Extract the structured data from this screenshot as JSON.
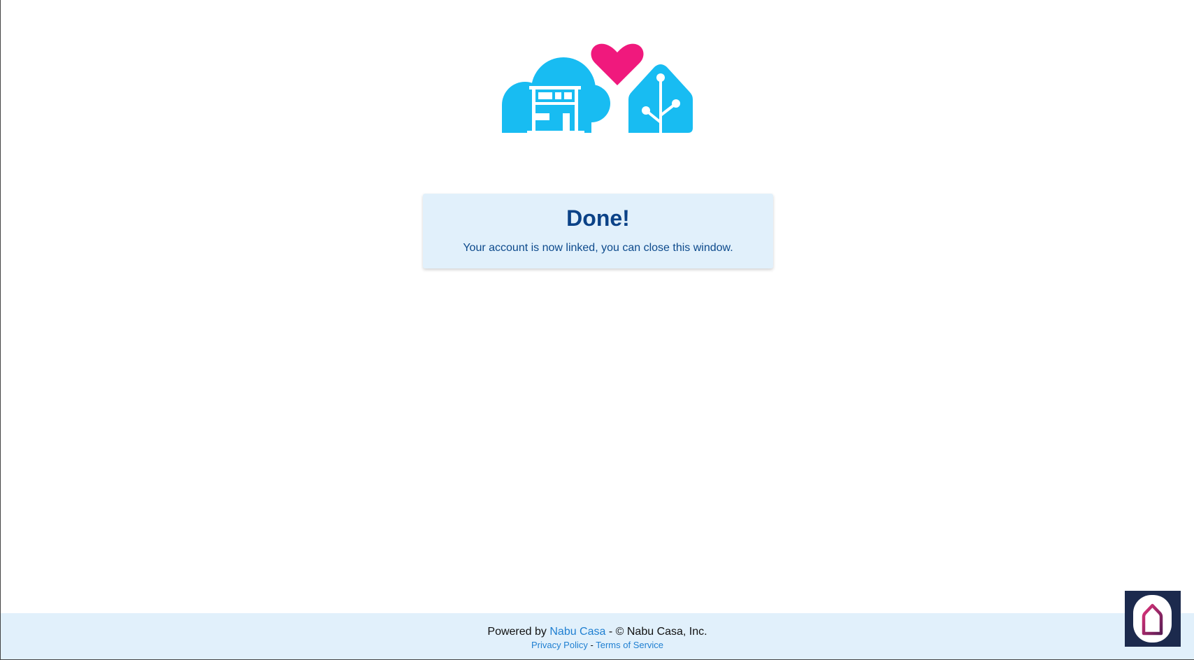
{
  "logo": {
    "icon": "nabu-casa-cloud-heart-home-logo",
    "colors": {
      "cloud": "#18bcf2",
      "heart": "#f0197d",
      "home": "#18bcf2"
    }
  },
  "card": {
    "title": "Done!",
    "message": "Your account is now linked, you can close this window."
  },
  "footer": {
    "powered_by": "Powered by",
    "nabu_casa_link": "Nabu Casa",
    "copyright": "- © Nabu Casa, Inc.",
    "privacy_link": "Privacy Policy",
    "separator": "-",
    "terms_link": "Terms of Service"
  },
  "app_badge": {
    "icon": "home-app-icon"
  }
}
